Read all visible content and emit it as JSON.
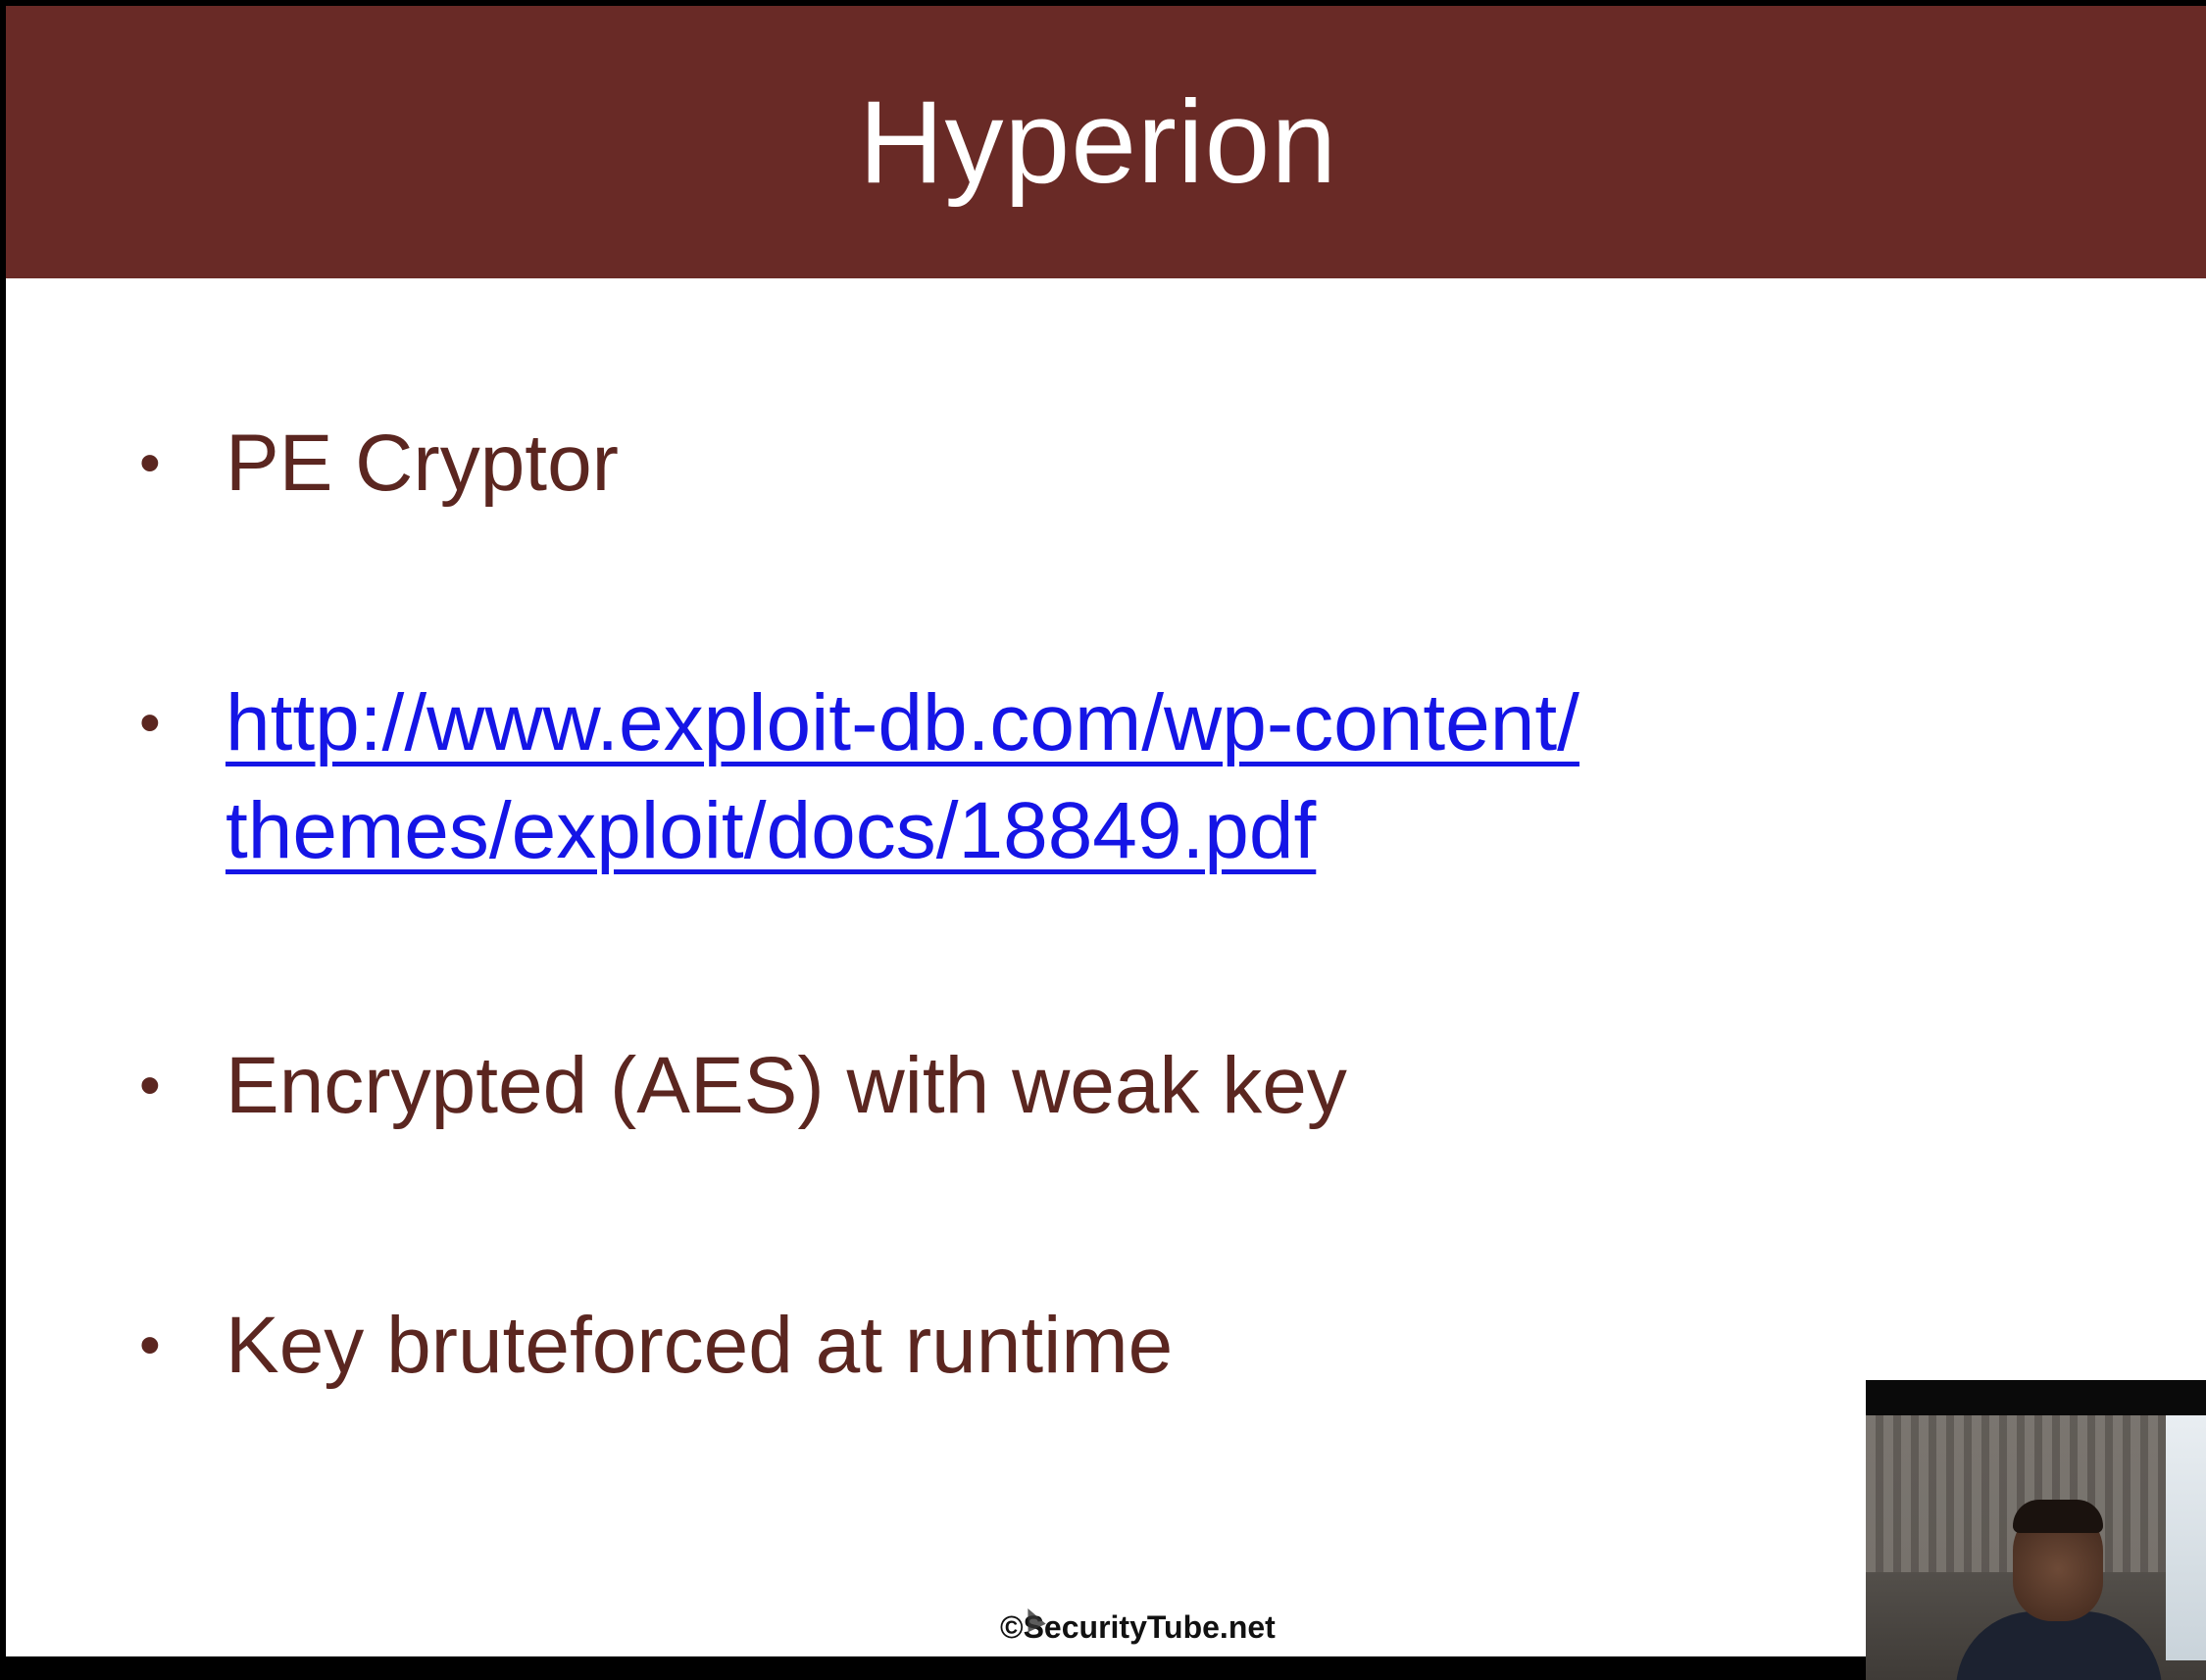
{
  "slide": {
    "title": "Hyperion",
    "bullets": [
      {
        "text": "PE Cryptor"
      },
      {
        "link_line1": "http://www.exploit-db.com/wp-content/",
        "link_line2": "themes/exploit/docs/18849.pdf"
      },
      {
        "text": "Encrypted (AES) with weak key"
      },
      {
        "text": "Key bruteforced at runtime"
      }
    ],
    "bullet_glyph": "•",
    "footer": "©SecurityTube.net"
  },
  "colors": {
    "title_bar": "#692a26",
    "title_text": "#ffffff",
    "body_text": "#5b2620",
    "link": "#1515e6",
    "background": "#ffffff"
  },
  "icons": {
    "cursor": "mouse-pointer-icon"
  }
}
